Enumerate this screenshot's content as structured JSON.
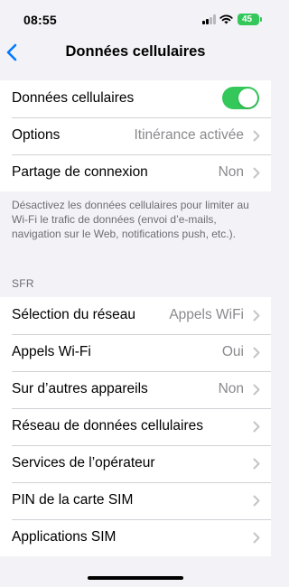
{
  "status_bar": {
    "time": "08:55",
    "battery": "45",
    "icons": [
      "signal-icon",
      "wifi-icon",
      "battery-icon"
    ],
    "battery_color": "#34c759"
  },
  "nav": {
    "back_icon": "chevron-left-icon",
    "title": "Données cellulaires"
  },
  "group1": {
    "cellular_label": "Données cellulaires",
    "cellular_enabled": true,
    "options_label": "Options",
    "options_value": "Itinérance activée",
    "hotspot_label": "Partage de connexion",
    "hotspot_value": "Non"
  },
  "footnote": "Désactivez les données cellulaires pour limiter au Wi-Fi le trafic de données (envoi d’e-mails, navigation sur le Web, notifications push, etc.).",
  "carrier": {
    "header": "SFR",
    "network_selection_label": "Sélection du réseau",
    "network_selection_value": "Appels WiFi",
    "wifi_calling_label": "Appels Wi-Fi",
    "wifi_calling_value": "Oui",
    "other_devices_label": "Sur d’autres appareils",
    "other_devices_value": "Non",
    "data_network_label": "Réseau de données cellulaires",
    "carrier_services_label": "Services de l’opérateur",
    "sim_pin_label": "PIN de la carte SIM",
    "sim_apps_label": "Applications SIM"
  },
  "colors": {
    "accent": "#007aff",
    "toggle_on": "#34c759",
    "background": "#f2f2f7",
    "secondary_text": "#8a8a8e"
  }
}
